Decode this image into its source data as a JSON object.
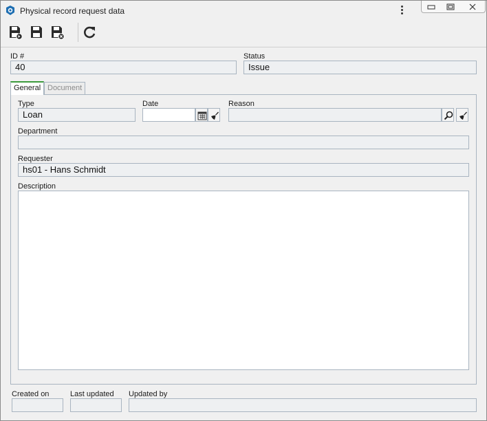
{
  "window": {
    "title": "Physical record request data",
    "icons": {
      "app": "app-logo-icon",
      "menu": "kebab-menu-icon",
      "minimize": "minimize-icon",
      "maximize": "maximize-icon",
      "close": "close-icon"
    }
  },
  "toolbar": {
    "buttons": [
      {
        "name": "save-and-new-button",
        "icon": "save-new-icon"
      },
      {
        "name": "save-button",
        "icon": "save-icon"
      },
      {
        "name": "save-and-close-button",
        "icon": "save-close-icon"
      },
      {
        "name": "refresh-button",
        "icon": "refresh-icon"
      }
    ]
  },
  "header": {
    "id_label": "ID #",
    "id_value": "40",
    "status_label": "Status",
    "status_value": "Issue"
  },
  "tabs": [
    {
      "label": "General",
      "active": true
    },
    {
      "label": "Document",
      "active": false
    }
  ],
  "general": {
    "type_label": "Type",
    "type_value": "Loan",
    "date_label": "Date",
    "date_value": "",
    "reason_label": "Reason",
    "reason_value": "",
    "department_label": "Department",
    "department_value": "",
    "requester_label": "Requester",
    "requester_value": "hs01 - Hans Schmidt",
    "description_label": "Description",
    "description_value": ""
  },
  "footer": {
    "created_label": "Created on",
    "created_value": "",
    "updated_label": "Last updated",
    "updated_value": "",
    "updated_by_label": "Updated by",
    "updated_by_value": ""
  },
  "colors": {
    "active_tab_accent": "#3b9a3b",
    "field_border": "#a8b4c0",
    "readonly_field_bg": "#eef0f2",
    "app_icon_blue": "#1f6fb2"
  }
}
